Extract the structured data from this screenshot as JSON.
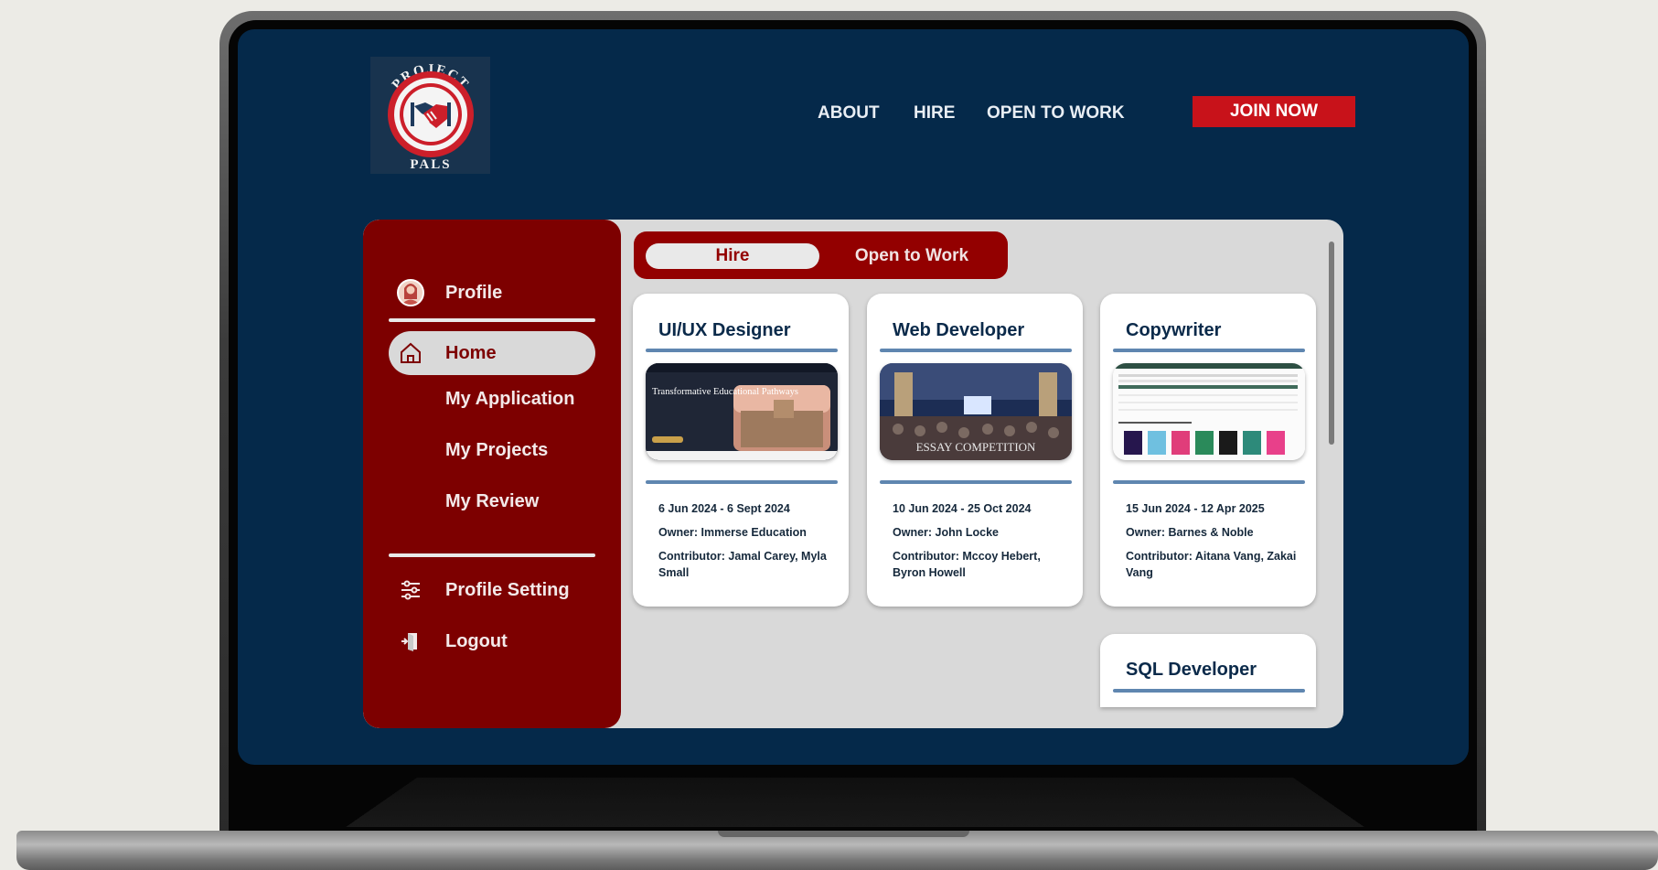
{
  "brand": {
    "logo_top_text": "PROJECT",
    "logo_bottom_text": "PALS"
  },
  "header": {
    "nav": [
      "ABOUT",
      "HIRE",
      "OPEN TO WORK"
    ],
    "join_label": "JOIN NOW"
  },
  "sidebar": {
    "profile": "Profile",
    "items": [
      "Home",
      "My Application",
      "My Projects",
      "My Review"
    ],
    "settings": "Profile Setting",
    "logout": "Logout",
    "active": "Home"
  },
  "tabs": {
    "hire": "Hire",
    "open_to_work": "Open to Work",
    "selected": "Hire"
  },
  "cards": [
    {
      "title": "UI/UX Designer",
      "dates": "6 Jun 2024 - 6 Sept 2024",
      "owner": "Owner: Immerse Education",
      "contributor": "Contributor: Jamal Carey, Myla Small",
      "thumb_text": "Transformative Educational Pathways"
    },
    {
      "title": "Web Developer",
      "dates": "10 Jun 2024 - 25 Oct 2024",
      "owner": "Owner: John Locke",
      "contributor": "Contributor: Mccoy Hebert, Byron Howell",
      "thumb_text": "ESSAY COMPETITION"
    },
    {
      "title": "Copywriter",
      "dates": "15 Jun 2024 - 12 Apr 2025",
      "owner": "Owner: Barnes & Noble",
      "contributor": "Contributor: Aitana Vang, Zakai Vang"
    },
    {
      "title": "SQL Developer"
    }
  ],
  "colors": {
    "screen_bg": "#05294a",
    "sidebar_bg": "#7d0000",
    "accent_red": "#c8121a",
    "rule_blue": "#5f86b0"
  }
}
